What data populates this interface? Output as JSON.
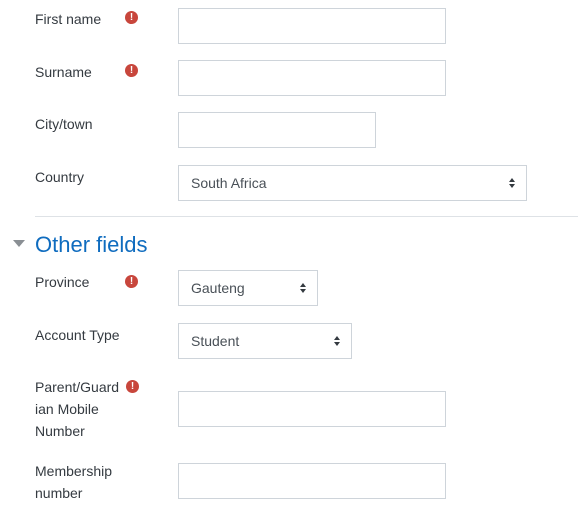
{
  "fields": {
    "first_name": {
      "label": "First name",
      "value": ""
    },
    "surname": {
      "label": "Surname",
      "value": ""
    },
    "city": {
      "label": "City/town",
      "value": ""
    },
    "country": {
      "label": "Country",
      "selected": "South Africa"
    }
  },
  "other_fields": {
    "title": "Other fields",
    "province": {
      "label": "Province",
      "selected": "Gauteng"
    },
    "account_type": {
      "label": "Account Type",
      "selected": "Student"
    },
    "parent_mobile": {
      "label_line1": "Parent/Guard",
      "label_line2": "ian Mobile",
      "label_line3": "Number",
      "value": ""
    },
    "membership": {
      "label_line1": "Membership",
      "label_line2": "number",
      "value": ""
    }
  },
  "icons": {
    "required": "exclamation-circle-icon",
    "select_caret": "sort-caret-icon",
    "section_toggle": "caret-down-icon"
  },
  "colors": {
    "required_icon": "#c8463c",
    "section_title": "#0f6cbf",
    "border": "#ced4da"
  }
}
